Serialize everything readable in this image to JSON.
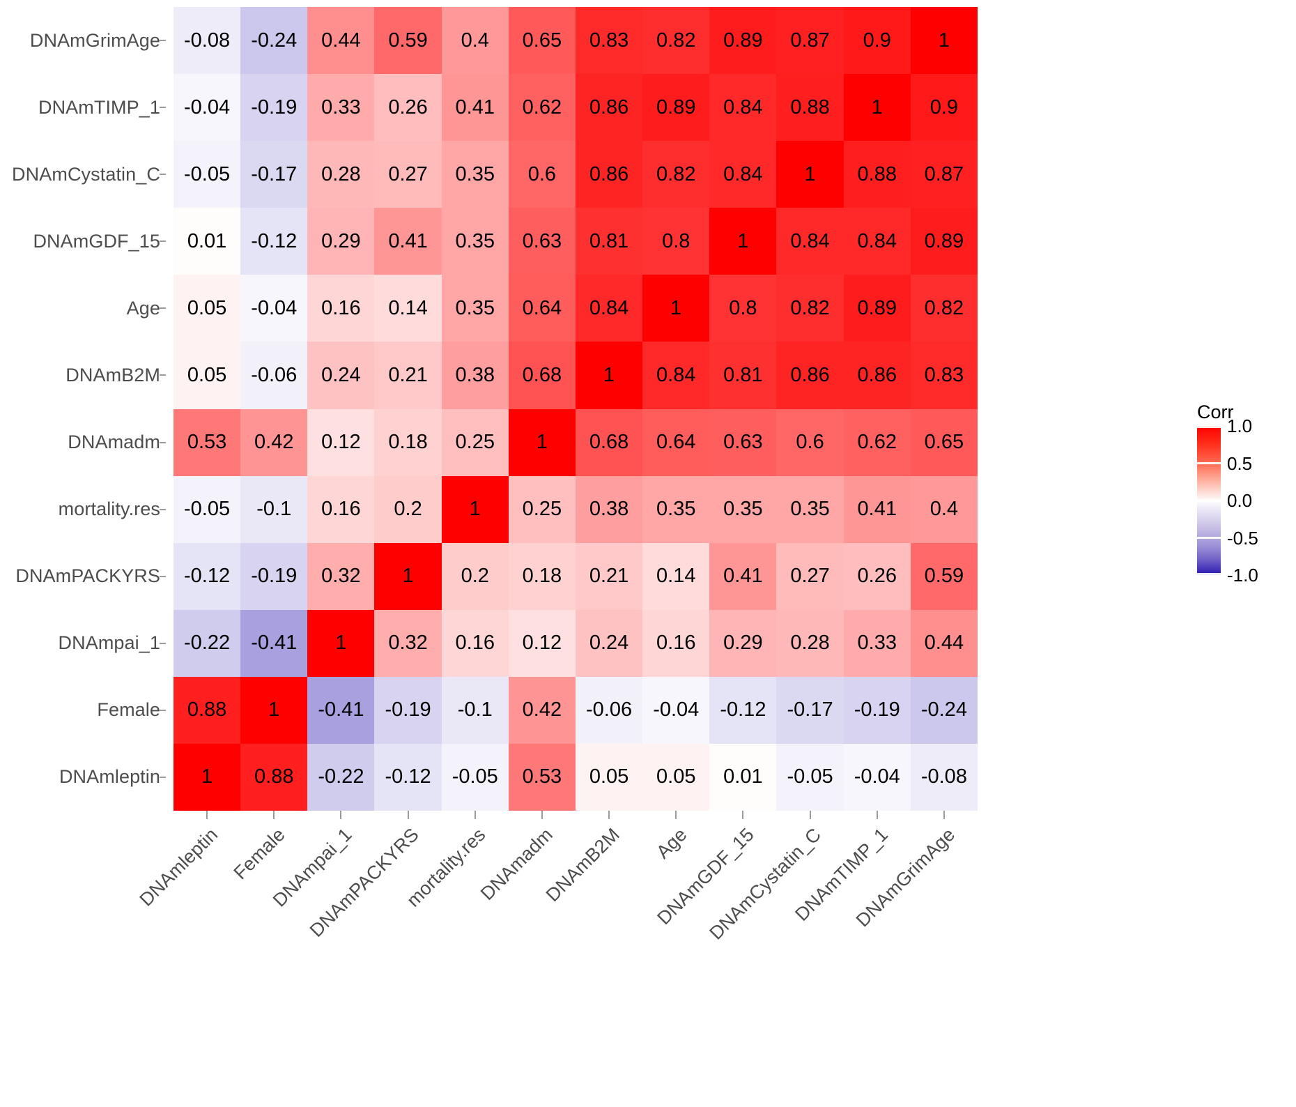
{
  "chart_data": {
    "type": "heatmap",
    "title": "",
    "xlabel": "",
    "ylabel": "",
    "legend_title": "Corr",
    "legend_position": "right",
    "grid": false,
    "zlim": [
      -1.0,
      1.0
    ],
    "legend_ticks": [
      "1.0",
      "0.5",
      "0.0",
      "-0.5",
      "-1.0"
    ],
    "legend_tick_values": [
      1.0,
      0.5,
      0.0,
      -0.5,
      -1.0
    ],
    "colorscale": {
      "low": "#2a17b0",
      "mid": "#ffffff",
      "high": "#ff0000"
    },
    "x_categories": [
      "DNAmleptin",
      "Female",
      "DNAmpai_1",
      "DNAmPACKYRS",
      "mortality.res",
      "DNAmadm",
      "DNAmB2M",
      "Age",
      "DNAmGDF_15",
      "DNAmCystatin_C",
      "DNAmTIMP_1",
      "DNAmGrimAge"
    ],
    "y_categories": [
      "DNAmGrimAge",
      "DNAmTIMP_1",
      "DNAmCystatin_C",
      "DNAmGDF_15",
      "Age",
      "DNAmB2M",
      "DNAmadm",
      "mortality.res",
      "DNAmPACKYRS",
      "DNAmpai_1",
      "Female",
      "DNAmleptin"
    ],
    "values": [
      [
        -0.08,
        -0.24,
        0.44,
        0.59,
        0.4,
        0.65,
        0.83,
        0.82,
        0.89,
        0.87,
        0.9,
        1
      ],
      [
        -0.04,
        -0.19,
        0.33,
        0.26,
        0.41,
        0.62,
        0.86,
        0.89,
        0.84,
        0.88,
        1,
        0.9
      ],
      [
        -0.05,
        -0.17,
        0.28,
        0.27,
        0.35,
        0.6,
        0.86,
        0.82,
        0.84,
        1,
        0.88,
        0.87
      ],
      [
        0.01,
        -0.12,
        0.29,
        0.41,
        0.35,
        0.63,
        0.81,
        0.8,
        1,
        0.84,
        0.84,
        0.89
      ],
      [
        0.05,
        -0.04,
        0.16,
        0.14,
        0.35,
        0.64,
        0.84,
        1,
        0.8,
        0.82,
        0.89,
        0.82
      ],
      [
        0.05,
        -0.06,
        0.24,
        0.21,
        0.38,
        0.68,
        1,
        0.84,
        0.81,
        0.86,
        0.86,
        0.83
      ],
      [
        0.53,
        0.42,
        0.12,
        0.18,
        0.25,
        1,
        0.68,
        0.64,
        0.63,
        0.6,
        0.62,
        0.65
      ],
      [
        -0.05,
        -0.1,
        0.16,
        0.2,
        1,
        0.25,
        0.38,
        0.35,
        0.35,
        0.35,
        0.41,
        0.4
      ],
      [
        -0.12,
        -0.19,
        0.32,
        1,
        0.2,
        0.18,
        0.21,
        0.14,
        0.41,
        0.27,
        0.26,
        0.59
      ],
      [
        -0.22,
        -0.41,
        1,
        0.32,
        0.16,
        0.12,
        0.24,
        0.16,
        0.29,
        0.28,
        0.33,
        0.44
      ],
      [
        0.88,
        1,
        -0.41,
        -0.19,
        -0.1,
        0.42,
        -0.06,
        -0.04,
        -0.12,
        -0.17,
        -0.19,
        -0.24
      ],
      [
        1,
        0.88,
        -0.22,
        -0.12,
        -0.05,
        0.53,
        0.05,
        0.05,
        0.01,
        -0.05,
        -0.04,
        -0.08
      ]
    ],
    "labels": [
      [
        "-0.08",
        "-0.24",
        "0.44",
        "0.59",
        "0.4",
        "0.65",
        "0.83",
        "0.82",
        "0.89",
        "0.87",
        "0.9",
        "1"
      ],
      [
        "-0.04",
        "-0.19",
        "0.33",
        "0.26",
        "0.41",
        "0.62",
        "0.86",
        "0.89",
        "0.84",
        "0.88",
        "1",
        "0.9"
      ],
      [
        "-0.05",
        "-0.17",
        "0.28",
        "0.27",
        "0.35",
        "0.6",
        "0.86",
        "0.82",
        "0.84",
        "1",
        "0.88",
        "0.87"
      ],
      [
        "0.01",
        "-0.12",
        "0.29",
        "0.41",
        "0.35",
        "0.63",
        "0.81",
        "0.8",
        "1",
        "0.84",
        "0.84",
        "0.89"
      ],
      [
        "0.05",
        "-0.04",
        "0.16",
        "0.14",
        "0.35",
        "0.64",
        "0.84",
        "1",
        "0.8",
        "0.82",
        "0.89",
        "0.82"
      ],
      [
        "0.05",
        "-0.06",
        "0.24",
        "0.21",
        "0.38",
        "0.68",
        "1",
        "0.84",
        "0.81",
        "0.86",
        "0.86",
        "0.83"
      ],
      [
        "0.53",
        "0.42",
        "0.12",
        "0.18",
        "0.25",
        "1",
        "0.68",
        "0.64",
        "0.63",
        "0.6",
        "0.62",
        "0.65"
      ],
      [
        "-0.05",
        "-0.1",
        "0.16",
        "0.2",
        "1",
        "0.25",
        "0.38",
        "0.35",
        "0.35",
        "0.35",
        "0.41",
        "0.4"
      ],
      [
        "-0.12",
        "-0.19",
        "0.32",
        "1",
        "0.2",
        "0.18",
        "0.21",
        "0.14",
        "0.41",
        "0.27",
        "0.26",
        "0.59"
      ],
      [
        "-0.22",
        "-0.41",
        "1",
        "0.32",
        "0.16",
        "0.12",
        "0.24",
        "0.16",
        "0.29",
        "0.28",
        "0.33",
        "0.44"
      ],
      [
        "0.88",
        "1",
        "-0.41",
        "-0.19",
        "-0.1",
        "0.42",
        "-0.06",
        "-0.04",
        "-0.12",
        "-0.17",
        "-0.19",
        "-0.24"
      ],
      [
        "1",
        "0.88",
        "-0.22",
        "-0.12",
        "-0.05",
        "0.53",
        "0.05",
        "0.05",
        "0.01",
        "-0.05",
        "-0.04",
        "-0.08"
      ]
    ]
  }
}
